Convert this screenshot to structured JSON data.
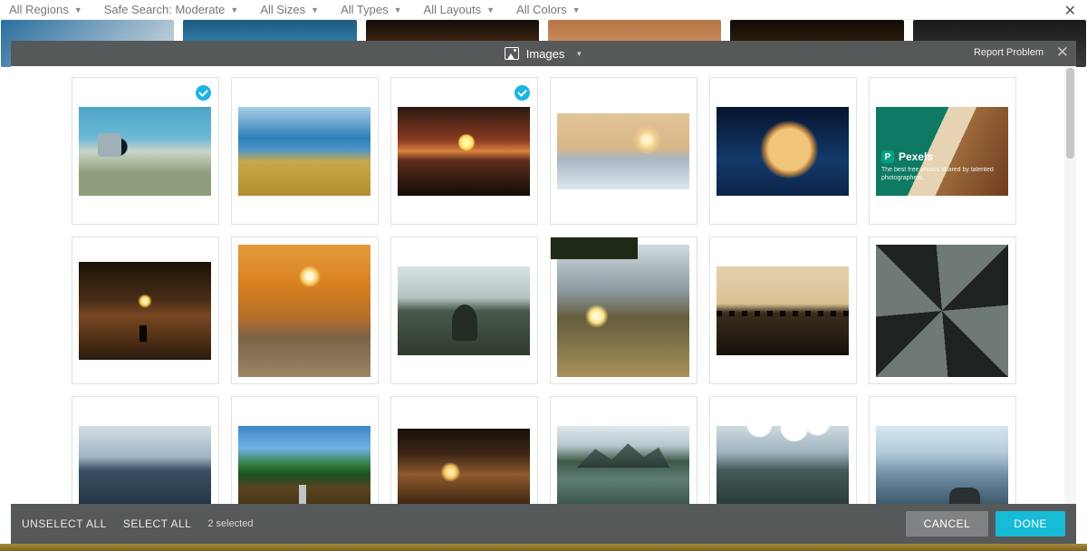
{
  "filters": {
    "regions": "All Regions",
    "safe_search": "Safe Search: Moderate",
    "sizes": "All Sizes",
    "types": "All Types",
    "layouts": "All Layouts",
    "colors": "All Colors"
  },
  "dialog": {
    "title": "Images",
    "report": "Report Problem"
  },
  "promoted": {
    "brand": "Pexels",
    "tagline": "The best free photos shared by talented photographers."
  },
  "footer": {
    "unselect_all": "UNSELECT ALL",
    "select_all": "SELECT ALL",
    "status": "2 selected",
    "cancel": "CANCEL",
    "done": "DONE"
  },
  "selected_indices": [
    0,
    2
  ]
}
